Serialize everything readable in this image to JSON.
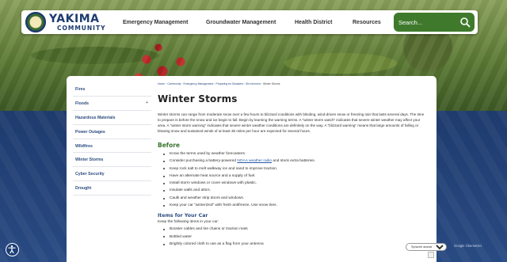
{
  "site": {
    "logo_main": "YAKIMA",
    "logo_sub": "COMMUNITY"
  },
  "nav": {
    "items": [
      {
        "label": "Emergency Management"
      },
      {
        "label": "Groundwater Management"
      },
      {
        "label": "Health District"
      },
      {
        "label": "Resources"
      }
    ]
  },
  "search": {
    "placeholder": "Search...",
    "icon": "search-icon"
  },
  "breadcrumb": {
    "items": [
      "Home",
      "Community",
      "Emergency Management",
      "Preparing for Disasters",
      "Be Informed"
    ],
    "separator": "›",
    "current": "Winter Storms"
  },
  "sidebar": {
    "items": [
      {
        "label": "Fires"
      },
      {
        "label": "Floods",
        "caret": "+"
      },
      {
        "label": "Hazardous Materials"
      },
      {
        "label": "Power Outages"
      },
      {
        "label": "Wildfires"
      },
      {
        "label": "Winter Storms"
      },
      {
        "label": "Cyber Security"
      },
      {
        "label": "Drought"
      }
    ]
  },
  "page": {
    "title": "Winter Storms",
    "intro": "Winter storms can range from moderate snow over a few hours to blizzard conditions with blinding, wind-driven snow or freezing rain that lasts several days. The time to prepare is before the snow and ice begin to fall. Begin by learning the warning terms. A \"winter storm watch\" indicates that severe winter weather may affect your area. A \"winter storm warning\" indicates that severe winter weather conditions are definitely on the way. A \"blizzard warning\" means that large amounts of falling or blowing snow and sustained winds of at least 35 miles per hour are expected for several hours.",
    "before_heading": "Before",
    "before_items": [
      {
        "pre": "Know the terms used by weather forecasters.",
        "link": "",
        "post": ""
      },
      {
        "pre": "Consider purchasing a battery-powered ",
        "link": "NOAA weather radio",
        "post": " and stock extra batteries."
      },
      {
        "pre": "Keep rock salt to melt walkway ice and sand to improve traction.",
        "link": "",
        "post": ""
      },
      {
        "pre": "Have an alternate heat source and a supply of fuel.",
        "link": "",
        "post": ""
      },
      {
        "pre": "Install storm windows or cover windows with plastic.",
        "link": "",
        "post": ""
      },
      {
        "pre": "Insulate walls and attics.",
        "link": "",
        "post": ""
      },
      {
        "pre": "Caulk and weather strip doors and windows.",
        "link": "",
        "post": ""
      },
      {
        "pre": "Keep your car \"winterized\" with fresh antifreeze. Use snow tires.",
        "link": "",
        "post": ""
      }
    ],
    "car_heading": "Items for Your Car",
    "car_note": "Keep the following items in your car:",
    "car_items": [
      "Booster cables and tire chains or traction mats",
      "Bottled water",
      "Brightly colored cloth to use as a flag from your antenna"
    ]
  },
  "widgets": {
    "language_select": "Sprache auswählen",
    "translate_brand": "Google Übersetzer",
    "accessibility_icon": "accessibility-icon"
  },
  "colors": {
    "brand_blue": "#1c3b71",
    "search_green": "#3f7a2c",
    "heading_green": "#3a7530",
    "link_blue": "#2c4c82"
  }
}
